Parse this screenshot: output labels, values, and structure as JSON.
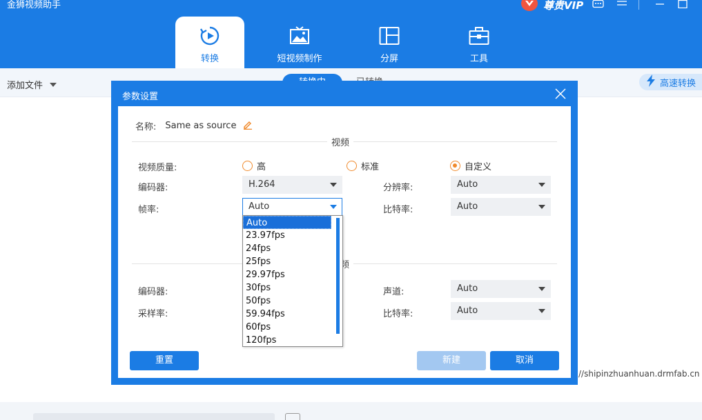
{
  "app": {
    "title": "金狮视频助手",
    "vip_label": "尊贵VIP"
  },
  "tabs": [
    {
      "label": "转换",
      "icon": "convert-icon",
      "active": true
    },
    {
      "label": "短视频制作",
      "icon": "image-icon",
      "active": false
    },
    {
      "label": "分屏",
      "icon": "split-screen-icon",
      "active": false
    },
    {
      "label": "工具",
      "icon": "toolbox-icon",
      "active": false
    }
  ],
  "toolbar": {
    "add_file": "添加文件",
    "segment_active": "转换中",
    "segment_inactive": "已转换",
    "fast_convert": "高速转换"
  },
  "background": {
    "url_text": "//shipinzhuanhuan.drmfab.cn"
  },
  "dialog": {
    "title": "参数设置",
    "name_label": "名称:",
    "name_value": "Same as source",
    "video_section": "视频",
    "audio_section": "音频",
    "quality_label": "视频质量:",
    "quality_options": [
      {
        "label": "高",
        "checked": false
      },
      {
        "label": "标准",
        "checked": false
      },
      {
        "label": "自定义",
        "checked": true
      }
    ],
    "video_encoder_label": "编码器:",
    "video_encoder_value": "H.264",
    "resolution_label": "分辨率:",
    "resolution_value": "Auto",
    "framerate_label": "帧率:",
    "framerate_value": "Auto",
    "video_bitrate_label": "比特率:",
    "video_bitrate_value": "Auto",
    "framerate_options": [
      "Auto",
      "23.97fps",
      "24fps",
      "25fps",
      "29.97fps",
      "30fps",
      "50fps",
      "59.94fps",
      "60fps",
      "120fps"
    ],
    "audio_encoder_label": "编码器:",
    "channel_label": "声道:",
    "channel_value": "Auto",
    "samplerate_label": "采样率:",
    "audio_bitrate_label": "比特率:",
    "audio_bitrate_value": "Auto",
    "reset_button": "重置",
    "new_button": "新建",
    "cancel_button": "取消"
  },
  "colors": {
    "brand_blue": "#1b7ce4",
    "radio_orange": "#f08a2c",
    "disabled_blue": "#a3c8f1"
  }
}
